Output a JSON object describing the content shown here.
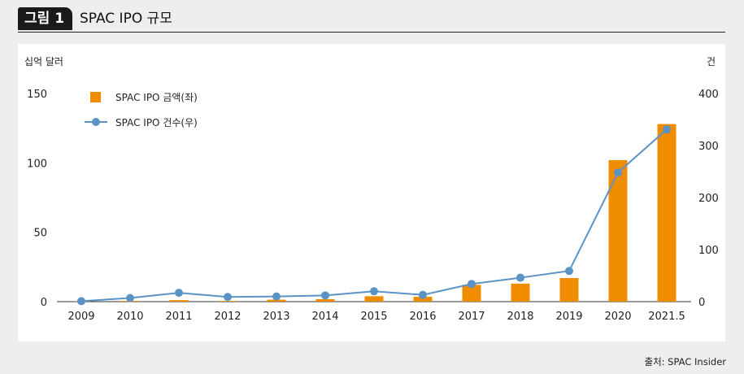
{
  "header": {
    "figure_label": "그림 1",
    "title": "SPAC IPO 규모"
  },
  "source": "출처: SPAC Insider",
  "chart_data": {
    "type": "bar+line",
    "categories": [
      "2009",
      "2010",
      "2011",
      "2012",
      "2013",
      "2014",
      "2015",
      "2016",
      "2017",
      "2018",
      "2019",
      "2020",
      "2021.5"
    ],
    "series": [
      {
        "name": "SPAC IPO 금액(좌)",
        "type": "bar",
        "axis": "left",
        "color": "#f08c00",
        "values": [
          0.1,
          0.5,
          1.1,
          0.5,
          1.4,
          1.8,
          3.9,
          3.5,
          12.1,
          13.0,
          17.0,
          102.0,
          128.0
        ]
      },
      {
        "name": "SPAC IPO 건수(우)",
        "type": "line",
        "axis": "right",
        "color": "#5b93c7",
        "values": [
          1,
          7,
          17,
          9,
          10,
          12,
          20,
          13,
          34,
          46,
          59,
          248,
          331
        ]
      }
    ],
    "y_left": {
      "label": "십억 달러",
      "ylim": [
        0,
        150
      ],
      "ticks": [
        0,
        50,
        100,
        150
      ]
    },
    "y_right": {
      "label": "건",
      "ylim": [
        0,
        400
      ],
      "ticks": [
        0,
        100,
        200,
        300,
        400
      ]
    },
    "legend_position": "top-left",
    "grid": false
  }
}
